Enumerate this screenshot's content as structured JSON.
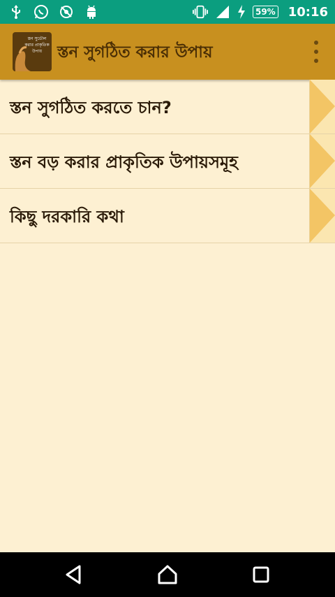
{
  "status_bar": {
    "battery": "59%",
    "time": "10:16",
    "icons": [
      "usb-icon",
      "whatsapp-icon",
      "sync-off-icon",
      "android-debug-icon",
      "vibrate-icon",
      "signal-icon",
      "charging-icon"
    ]
  },
  "app_bar": {
    "title": "স্তন সুগঠিত করার উপায়",
    "logo_text": "স্তন সুডৌল করার প্রাকৃতিক উপায়"
  },
  "list": {
    "items": [
      {
        "label": "স্তন সুগঠিত করতে চান?"
      },
      {
        "label": "স্তন বড় করার প্রাকৃতিক উপায়সমূহ"
      },
      {
        "label": "কিছু দরকারি কথা"
      }
    ]
  },
  "colors": {
    "status_bar": "#0b9e7f",
    "app_bar": "#c8901f",
    "background": "#fdf0d2",
    "arrow": "#f3c565"
  }
}
